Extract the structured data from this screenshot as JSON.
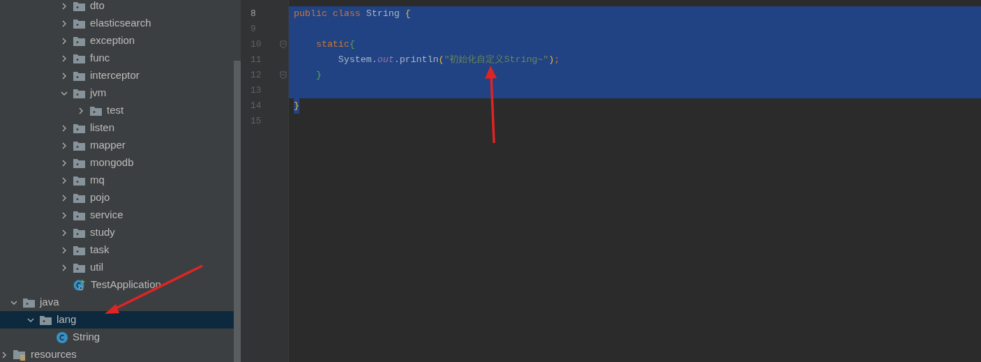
{
  "project_tree": [
    {
      "children": [
        {
          "children": [
            {
              "children": [
                {
                  "children": [
                    {
                      "label": "dto",
                      "kind": "folder",
                      "expanded": false,
                      "selected": false
                    },
                    {
                      "label": "elasticsearch",
                      "kind": "folder",
                      "expanded": false,
                      "selected": false
                    },
                    {
                      "label": "exception",
                      "kind": "folder",
                      "expanded": false,
                      "selected": false
                    },
                    {
                      "label": "func",
                      "kind": "folder",
                      "expanded": false,
                      "selected": false
                    },
                    {
                      "label": "interceptor",
                      "kind": "folder",
                      "expanded": false,
                      "selected": false
                    },
                    {
                      "label": "jvm",
                      "kind": "folder",
                      "expanded": true,
                      "selected": false,
                      "children": [
                        {
                          "label": "test",
                          "kind": "folder",
                          "expanded": false,
                          "selected": false
                        }
                      ]
                    },
                    {
                      "label": "listen",
                      "kind": "folder",
                      "expanded": false,
                      "selected": false
                    },
                    {
                      "label": "mapper",
                      "kind": "folder",
                      "expanded": false,
                      "selected": false
                    },
                    {
                      "label": "mongodb",
                      "kind": "folder",
                      "expanded": false,
                      "selected": false
                    },
                    {
                      "label": "mq",
                      "kind": "folder",
                      "expanded": false,
                      "selected": false
                    },
                    {
                      "label": "pojo",
                      "kind": "folder",
                      "expanded": false,
                      "selected": false
                    },
                    {
                      "label": "service",
                      "kind": "folder",
                      "expanded": false,
                      "selected": false
                    },
                    {
                      "label": "study",
                      "kind": "folder",
                      "expanded": false,
                      "selected": false
                    },
                    {
                      "label": "task",
                      "kind": "folder",
                      "expanded": false,
                      "selected": false
                    },
                    {
                      "label": "util",
                      "kind": "folder",
                      "expanded": false,
                      "selected": false
                    },
                    {
                      "label": "TestApplication",
                      "kind": "app",
                      "selected": false
                    }
                  ]
                }
              ]
            }
          ]
        },
        {
          "label": "java",
          "kind": "folder",
          "expanded": true,
          "selected": false,
          "children": [
            {
              "label": "lang",
              "kind": "folder",
              "expanded": true,
              "selected": true,
              "children": [
                {
                  "label": "String",
                  "kind": "class",
                  "selected": false
                }
              ]
            }
          ]
        }
      ]
    },
    {
      "label": "resources",
      "kind": "resources",
      "expanded": false,
      "selected": false
    }
  ],
  "editor": {
    "lines": [
      {
        "number": "8",
        "current": true,
        "selected": true,
        "tokens": [
          {
            "text": "public class ",
            "kind": "keyword"
          },
          {
            "text": "String ",
            "kind": "plain"
          },
          {
            "text": "{",
            "kind": "bracket1"
          }
        ]
      },
      {
        "number": "9",
        "current": false,
        "selected": true
      },
      {
        "number": "10",
        "current": false,
        "selected": true,
        "fold": true,
        "tokens": [
          {
            "text": "    static",
            "kind": "keyword"
          },
          {
            "text": "{",
            "kind": "bracket2"
          }
        ]
      },
      {
        "number": "11",
        "current": false,
        "selected": true,
        "tokens": [
          {
            "text": "        System.",
            "kind": "plain"
          },
          {
            "text": "out",
            "kind": "field"
          },
          {
            "text": ".println",
            "kind": "plain"
          },
          {
            "text": "(",
            "kind": "bracket1"
          },
          {
            "text": "\"初始化自定义String~\"",
            "kind": "string"
          },
          {
            "text": ")",
            "kind": "bracket1"
          },
          {
            "text": ";",
            "kind": "keyword"
          }
        ]
      },
      {
        "number": "12",
        "current": false,
        "selected": true,
        "fold": true,
        "tokens": [
          {
            "text": "    }",
            "kind": "bracket2"
          }
        ]
      },
      {
        "number": "13",
        "current": false,
        "selected": true
      },
      {
        "number": "14",
        "current": false,
        "selected": false,
        "tokens": [
          {
            "text": "}",
            "kind": "bracket1",
            "selected": true
          }
        ]
      },
      {
        "number": "15",
        "current": false,
        "selected": false
      }
    ]
  }
}
